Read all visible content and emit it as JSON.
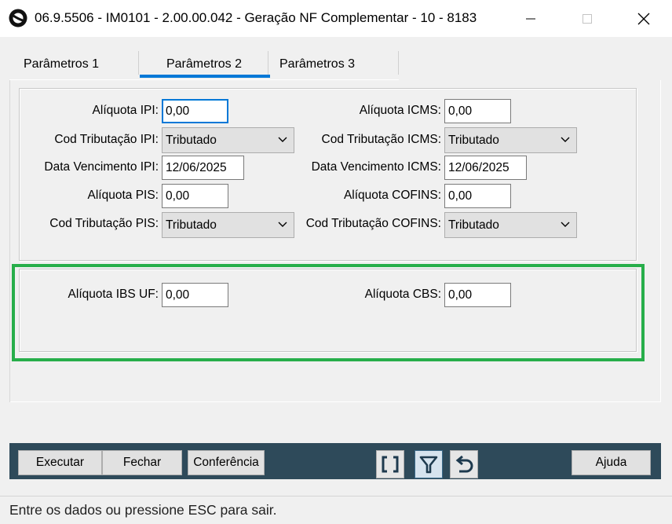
{
  "window": {
    "title": "06.9.5506 - IM0101 - 2.00.00.042 - Geração NF Complementar - 10 - 8183",
    "app_icon": "totvs-logo-icon",
    "controls": [
      "minimize-icon",
      "maximize-icon",
      "close-icon"
    ]
  },
  "tabs": [
    {
      "label": "Parâmetros 1",
      "selected": false
    },
    {
      "label": "Parâmetros 2",
      "selected": true
    },
    {
      "label": "Parâmetros 3",
      "selected": false
    }
  ],
  "form": {
    "aliquota_ipi": {
      "label": "Alíquota IPI:",
      "value": "0,00"
    },
    "cod_trib_ipi": {
      "label": "Cod Tributação IPI:",
      "value": "Tributado"
    },
    "data_venc_ipi": {
      "label": "Data Vencimento IPI:",
      "value": "12/06/2025"
    },
    "aliquota_pis": {
      "label": "Alíquota PIS:",
      "value": "0,00"
    },
    "cod_trib_pis": {
      "label": "Cod Tributação PIS:",
      "value": "Tributado"
    },
    "aliquota_icms": {
      "label": "Alíquota ICMS:",
      "value": "0,00"
    },
    "cod_trib_icms": {
      "label": "Cod Tributação ICMS:",
      "value": "Tributado"
    },
    "data_venc_icms": {
      "label": "Data Vencimento ICMS:",
      "value": "12/06/2025"
    },
    "aliquota_cofins": {
      "label": "Alíquota COFINS:",
      "value": "0,00"
    },
    "cod_trib_cofins": {
      "label": "Cod Tributação COFINS:",
      "value": "Tributado"
    },
    "aliquota_ibs_uf": {
      "label": "Alíquota IBS UF:",
      "value": "0,00"
    },
    "aliquota_cbs": {
      "label": "Alíquota CBS:",
      "value": "0,00"
    }
  },
  "toolbar": {
    "executar": "Executar",
    "fechar": "Fechar",
    "conferencia": "Conferência",
    "ajuda": "Ajuda",
    "icons": [
      "brackets-icon",
      "filter-icon",
      "undo-icon"
    ],
    "colors": {
      "toolbar_bg": "#2e4a5a",
      "highlight": "#27ae4a",
      "accent": "#0078d7"
    }
  },
  "status": {
    "text": "Entre os dados ou pressione ESC para sair."
  }
}
